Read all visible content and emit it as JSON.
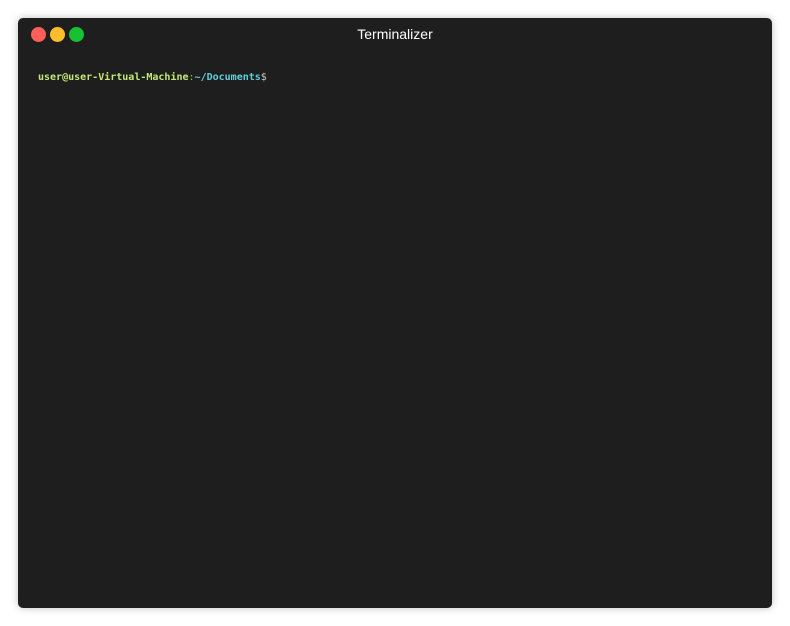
{
  "window": {
    "title": "Terminalizer"
  },
  "controls": {
    "close_icon": "close-dot",
    "minimize_icon": "minimize-dot",
    "maximize_icon": "maximize-dot"
  },
  "terminal": {
    "prompt": {
      "user_host": "user@user-Virtual-Machine",
      "separator": ":",
      "path": "~/Documents",
      "symbol": "$"
    }
  },
  "colors": {
    "background": "#1e1e1e",
    "close": "#ff5f58",
    "minimize": "#ffbd2e",
    "maximize": "#18c132",
    "user_host": "#c4e877",
    "path": "#5fcfdb"
  }
}
